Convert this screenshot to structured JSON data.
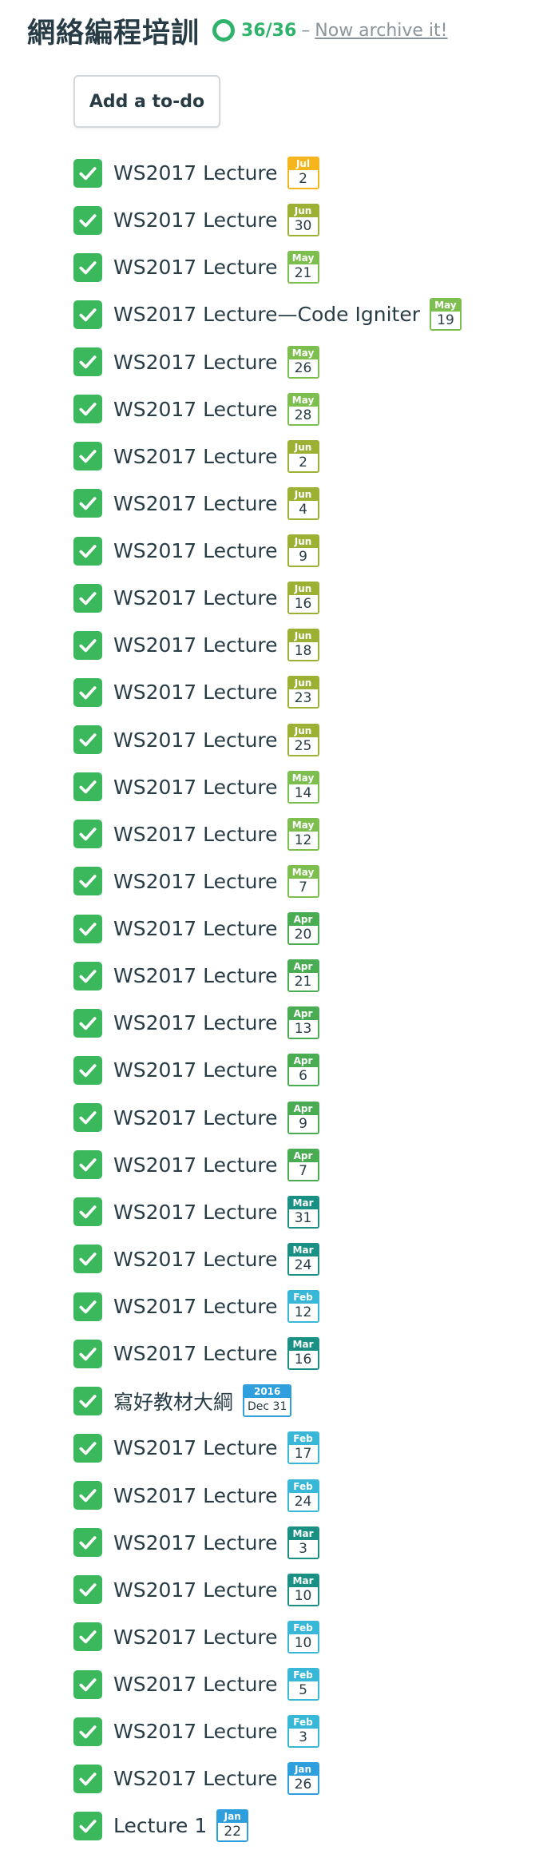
{
  "header": {
    "title": "網絡編程培訓",
    "count": "36/36",
    "separator": "–",
    "archive_link": "Now archive it!"
  },
  "add_button": {
    "label": "Add a to-do"
  },
  "colors": {
    "progress": "#2fb26a",
    "check": "#3cb85c",
    "jul": "#f5b51c",
    "jun": "#9cb034",
    "may": "#7dbf4e",
    "apr": "#4aac52",
    "mar": "#1a8f83",
    "feb": "#38b7d6",
    "jan": "#2f9edd",
    "year": "#2f9edd"
  },
  "todos": [
    {
      "text": "WS2017 Lecture",
      "month": "Jul",
      "day": "2",
      "color": "#f5b51c"
    },
    {
      "text": "WS2017 Lecture",
      "month": "Jun",
      "day": "30",
      "color": "#9cb034"
    },
    {
      "text": "WS2017 Lecture",
      "month": "May",
      "day": "21",
      "color": "#7dbf4e"
    },
    {
      "text": "WS2017 Lecture—Code Igniter",
      "month": "May",
      "day": "19",
      "color": "#7dbf4e"
    },
    {
      "text": "WS2017 Lecture",
      "month": "May",
      "day": "26",
      "color": "#7dbf4e"
    },
    {
      "text": "WS2017 Lecture",
      "month": "May",
      "day": "28",
      "color": "#7dbf4e"
    },
    {
      "text": "WS2017 Lecture",
      "month": "Jun",
      "day": "2",
      "color": "#9cb034"
    },
    {
      "text": "WS2017 Lecture",
      "month": "Jun",
      "day": "4",
      "color": "#9cb034"
    },
    {
      "text": "WS2017 Lecture",
      "month": "Jun",
      "day": "9",
      "color": "#9cb034"
    },
    {
      "text": "WS2017 Lecture",
      "month": "Jun",
      "day": "16",
      "color": "#9cb034"
    },
    {
      "text": "WS2017 Lecture",
      "month": "Jun",
      "day": "18",
      "color": "#9cb034"
    },
    {
      "text": "WS2017 Lecture",
      "month": "Jun",
      "day": "23",
      "color": "#9cb034"
    },
    {
      "text": "WS2017 Lecture",
      "month": "Jun",
      "day": "25",
      "color": "#9cb034"
    },
    {
      "text": "WS2017 Lecture",
      "month": "May",
      "day": "14",
      "color": "#7dbf4e"
    },
    {
      "text": "WS2017 Lecture",
      "month": "May",
      "day": "12",
      "color": "#7dbf4e"
    },
    {
      "text": "WS2017 Lecture",
      "month": "May",
      "day": "7",
      "color": "#7dbf4e"
    },
    {
      "text": "WS2017 Lecture",
      "month": "Apr",
      "day": "20",
      "color": "#4aac52"
    },
    {
      "text": "WS2017 Lecture",
      "month": "Apr",
      "day": "21",
      "color": "#4aac52"
    },
    {
      "text": "WS2017 Lecture",
      "month": "Apr",
      "day": "13",
      "color": "#4aac52"
    },
    {
      "text": "WS2017 Lecture",
      "month": "Apr",
      "day": "6",
      "color": "#4aac52"
    },
    {
      "text": "WS2017 Lecture",
      "month": "Apr",
      "day": "9",
      "color": "#4aac52"
    },
    {
      "text": "WS2017 Lecture",
      "month": "Apr",
      "day": "7",
      "color": "#4aac52"
    },
    {
      "text": "WS2017 Lecture",
      "month": "Mar",
      "day": "31",
      "color": "#1a8f83"
    },
    {
      "text": "WS2017 Lecture",
      "month": "Mar",
      "day": "24",
      "color": "#1a8f83"
    },
    {
      "text": "WS2017 Lecture",
      "month": "Feb",
      "day": "12",
      "color": "#38b7d6"
    },
    {
      "text": "WS2017 Lecture",
      "month": "Mar",
      "day": "16",
      "color": "#1a8f83"
    },
    {
      "text": "寫好教材大綱",
      "month": "2016",
      "day": "Dec 31",
      "color": "#2f9edd"
    },
    {
      "text": "WS2017 Lecture",
      "month": "Feb",
      "day": "17",
      "color": "#38b7d6"
    },
    {
      "text": "WS2017 Lecture",
      "month": "Feb",
      "day": "24",
      "color": "#38b7d6"
    },
    {
      "text": "WS2017 Lecture",
      "month": "Mar",
      "day": "3",
      "color": "#1a8f83"
    },
    {
      "text": "WS2017 Lecture",
      "month": "Mar",
      "day": "10",
      "color": "#1a8f83"
    },
    {
      "text": "WS2017 Lecture",
      "month": "Feb",
      "day": "10",
      "color": "#38b7d6"
    },
    {
      "text": "WS2017 Lecture",
      "month": "Feb",
      "day": "5",
      "color": "#38b7d6"
    },
    {
      "text": "WS2017 Lecture",
      "month": "Feb",
      "day": "3",
      "color": "#38b7d6"
    },
    {
      "text": "WS2017 Lecture",
      "month": "Jan",
      "day": "26",
      "color": "#2f9edd"
    },
    {
      "text": "Lecture 1",
      "month": "Jan",
      "day": "22",
      "color": "#2f9edd"
    }
  ]
}
